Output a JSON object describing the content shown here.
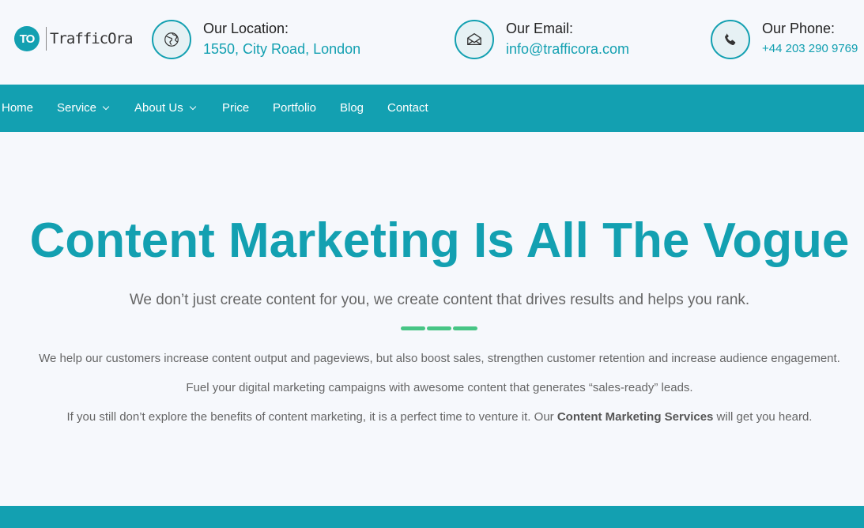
{
  "brand": {
    "logo_mark": "TO",
    "name": "TrafficOra"
  },
  "contacts": [
    {
      "label": "Our Location:",
      "value": "1550, City Road, London",
      "icon": "globe-icon"
    },
    {
      "label": "Our Email:",
      "value": "info@trafficora.com",
      "icon": "envelope-icon"
    },
    {
      "label": "Our Phone:",
      "value": "+44 203 290 9769",
      "icon": "phone-icon"
    }
  ],
  "nav": {
    "items": [
      {
        "label": "Home"
      },
      {
        "label": "Service",
        "has_dropdown": true
      },
      {
        "label": "About Us",
        "has_dropdown": true
      },
      {
        "label": "Price"
      },
      {
        "label": "Portfolio"
      },
      {
        "label": "Blog"
      },
      {
        "label": "Contact"
      }
    ]
  },
  "hero": {
    "title": "Content Marketing Is All The Vogue",
    "subtitle": "We don’t just create content for you, we create content that drives results and helps you rank.",
    "paragraphs": [
      "We help our customers increase content output and pageviews, but also boost sales, strengthen customer retention and increase audience engagement.",
      "Fuel your digital marketing campaigns with awesome content that generates “sales-ready” leads."
    ],
    "p3_before": "If you still don’t explore the benefits of content marketing, it is a perfect time to venture it. Our ",
    "p3_bold": "Content Marketing Services",
    "p3_after": " will get you heard."
  },
  "colors": {
    "accent": "#13a0b1",
    "divider": "#47c585",
    "background": "#f6f8fc"
  }
}
